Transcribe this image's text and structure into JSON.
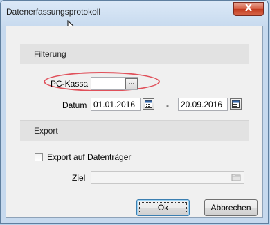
{
  "window": {
    "title": "Datenerfassungsprotokoll",
    "close_glyph": "X"
  },
  "filter": {
    "section_title": "Filterung",
    "pc_kassa_label": "PC-Kassa",
    "pc_kassa_value": "",
    "browse_label": "...",
    "datum_label": "Datum",
    "date_from": "01.01.2016",
    "date_separator": "-",
    "date_to": "20.09.2016"
  },
  "export": {
    "section_title": "Export",
    "checkbox_label": "Export auf Datenträger",
    "checked": false,
    "ziel_label": "Ziel",
    "ziel_value": ""
  },
  "buttons": {
    "ok": "Ok",
    "cancel": "Abbrechen"
  },
  "colors": {
    "highlight": "#e0505a",
    "close_button": "#c13a1f",
    "window_frame": "#c6d9ee"
  }
}
